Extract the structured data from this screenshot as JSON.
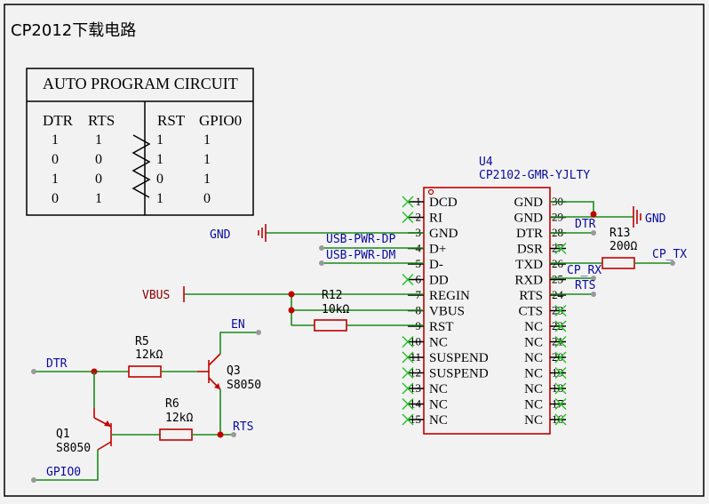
{
  "title": "CP2012下载电路",
  "auto_table": {
    "title": "AUTO PROGRAM CIRCUIT",
    "left_headers": [
      "DTR",
      "RTS"
    ],
    "right_headers": [
      "RST",
      "GPIO0"
    ],
    "rows": [
      {
        "dtr": "1",
        "rts": "1",
        "rst": "1",
        "gpio0": "1"
      },
      {
        "dtr": "0",
        "rts": "0",
        "rst": "1",
        "gpio0": "1"
      },
      {
        "dtr": "1",
        "rts": "0",
        "rst": "0",
        "gpio0": "1"
      },
      {
        "dtr": "0",
        "rts": "1",
        "rst": "1",
        "gpio0": "0"
      }
    ]
  },
  "chip": {
    "ref": "U4",
    "part": "CP2102-GMR-YJLTY",
    "left_pins": [
      {
        "num": "1",
        "name": "DCD"
      },
      {
        "num": "2",
        "name": "RI"
      },
      {
        "num": "3",
        "name": "GND"
      },
      {
        "num": "4",
        "name": "D+"
      },
      {
        "num": "5",
        "name": "D-"
      },
      {
        "num": "6",
        "name": "DD"
      },
      {
        "num": "7",
        "name": "REGIN"
      },
      {
        "num": "8",
        "name": "VBUS"
      },
      {
        "num": "9",
        "name": "RST"
      },
      {
        "num": "10",
        "name": "NC"
      },
      {
        "num": "11",
        "name": "SUSPEND"
      },
      {
        "num": "12",
        "name": "SUSPEND"
      },
      {
        "num": "13",
        "name": "NC"
      },
      {
        "num": "14",
        "name": "NC"
      },
      {
        "num": "15",
        "name": "NC"
      }
    ],
    "right_pins": [
      {
        "num": "30",
        "name": "GND"
      },
      {
        "num": "29",
        "name": "GND"
      },
      {
        "num": "28",
        "name": "DTR"
      },
      {
        "num": "27",
        "name": "DSR"
      },
      {
        "num": "26",
        "name": "TXD"
      },
      {
        "num": "25",
        "name": "RXD"
      },
      {
        "num": "24",
        "name": "RTS"
      },
      {
        "num": "23",
        "name": "CTS"
      },
      {
        "num": "22",
        "name": "NC"
      },
      {
        "num": "21",
        "name": "NC"
      },
      {
        "num": "20",
        "name": "NC"
      },
      {
        "num": "19",
        "name": "NC"
      },
      {
        "num": "18",
        "name": "NC"
      },
      {
        "num": "17",
        "name": "NC"
      },
      {
        "num": "16",
        "name": "NC"
      }
    ]
  },
  "nets": {
    "gnd_left": "GND",
    "gnd_right": "GND",
    "usb_dp": "USB-PWR-DP",
    "usb_dm": "USB-PWR-DM",
    "vbus": "VBUS",
    "dtr_right": "DTR",
    "cp_rx": "CP_RX",
    "rts_right": "RTS",
    "cp_tx": "CP_TX",
    "en": "EN",
    "dtr_left": "DTR",
    "rts_left": "RTS",
    "gpio0": "GPIO0"
  },
  "parts": {
    "r12": {
      "ref": "R12",
      "value": "10kΩ"
    },
    "r13": {
      "ref": "R13",
      "value": "200Ω"
    },
    "r5": {
      "ref": "R5",
      "value": "12kΩ"
    },
    "r6": {
      "ref": "R6",
      "value": "12kΩ"
    },
    "q3": {
      "ref": "Q3",
      "value": "S8050"
    },
    "q1": {
      "ref": "Q1",
      "value": "S8050"
    }
  }
}
